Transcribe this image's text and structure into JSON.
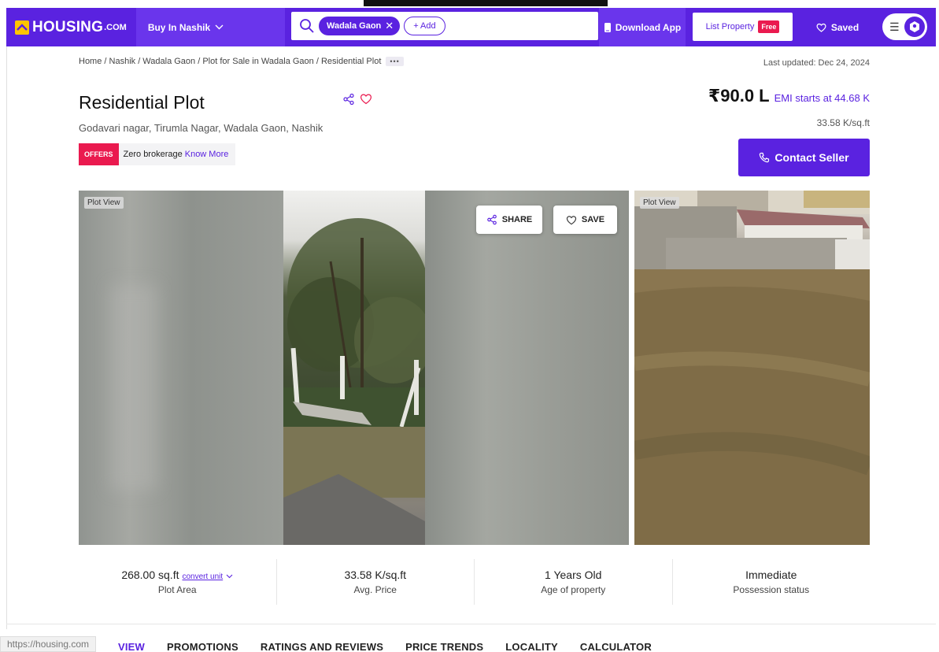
{
  "header": {
    "logo_text": "HOUSING",
    "logo_suffix": ".COM",
    "buy_in": "Buy In Nashik",
    "search_chip": "Wadala Gaon",
    "add_label": "+ Add",
    "download_app": "Download App",
    "list_property": "List Property",
    "free_badge": "Free",
    "saved": "Saved"
  },
  "breadcrumb": {
    "items": [
      "Home",
      "Nashik",
      "Wadala Gaon",
      "Plot for Sale in Wadala Gaon",
      "Residential Plot"
    ],
    "text": "Home / Nashik / Wadala Gaon / Plot for Sale in Wadala Gaon / Residential Plot",
    "more": "•••"
  },
  "last_updated": "Last updated: Dec 24, 2024",
  "listing": {
    "title": "Residential Plot",
    "address": "Godavari nagar, Tirumla Nagar, Wadala Gaon, Nashik",
    "offers_badge": "OFFERS",
    "offer_text": "Zero brokerage",
    "know_more": "Know More",
    "price": "₹90.0 L",
    "emi": "EMI starts at  44.68 K",
    "per_sqft": "33.58 K/sq.ft",
    "contact_seller": "Contact Seller"
  },
  "gallery": {
    "main_label": "Plot View",
    "side_label": "Plot View",
    "share": "SHARE",
    "save": "SAVE"
  },
  "stats": [
    {
      "value": "268.00 sq.ft",
      "extra": "convert unit",
      "label": "Plot Area"
    },
    {
      "value": "33.58 K/sq.ft",
      "label": "Avg. Price"
    },
    {
      "value": "1 Years Old",
      "label": "Age of property"
    },
    {
      "value": "Immediate",
      "label": "Possession status"
    }
  ],
  "tabs": [
    "VIEW",
    "PROMOTIONS",
    "RATINGS AND REVIEWS",
    "PRICE TRENDS",
    "LOCALITY",
    "CALCULATOR"
  ],
  "status_url": "https://housing.com",
  "colors": {
    "brand": "#5a22e0",
    "offer": "#ea1a4f",
    "logo": "#ffc400"
  }
}
